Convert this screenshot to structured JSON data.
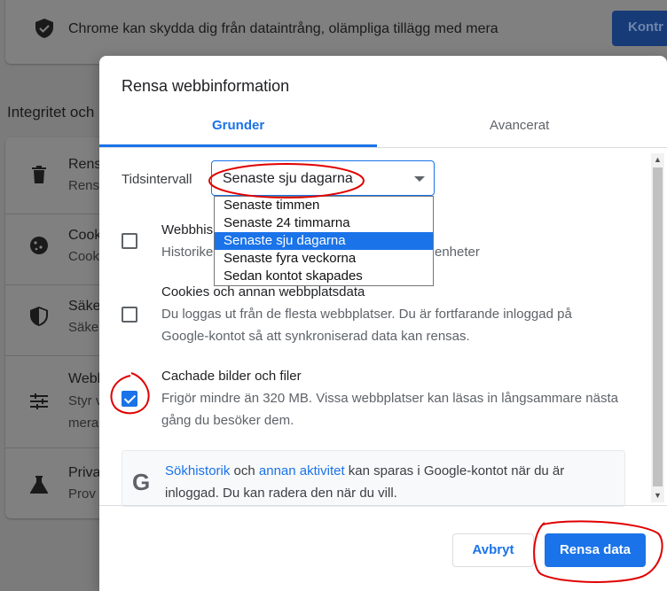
{
  "background": {
    "safety_banner": "Chrome kan skydda dig från dataintrång, olämpliga tillägg med mera",
    "safety_button": "Kontr",
    "section_title": "Integritet och",
    "rows": [
      {
        "icon": "trash-icon",
        "title": "Rens",
        "subtitle": "Rens"
      },
      {
        "icon": "cookie-icon",
        "title": "Cook",
        "subtitle": "Cook"
      },
      {
        "icon": "shield-icon",
        "title": "Säke",
        "subtitle": "Säke"
      },
      {
        "icon": "tune-icon",
        "title": "Webb",
        "subtitle": "Styr v",
        "subtitle2": "mera"
      },
      {
        "icon": "flask-icon",
        "title": "Priva",
        "subtitle": "Prov"
      }
    ]
  },
  "dialog": {
    "title": "Rensa webbinformation",
    "tabs": [
      {
        "label": "Grunder",
        "selected": true
      },
      {
        "label": "Avancerat",
        "selected": false
      }
    ],
    "time_range": {
      "label": "Tidsintervall",
      "value": "Senaste sju dagarna",
      "options": [
        "Senaste timmen",
        "Senaste 24 timmarna",
        "Senaste sju dagarna",
        "Senaste fyra veckorna",
        "Sedan kontot skapades"
      ],
      "selected_index": 2
    },
    "items": [
      {
        "title": "Webbhis",
        "desc": "Historike",
        "desc_tail": "enheter",
        "checked": false
      },
      {
        "title": "Cookies och annan webbplatsdata",
        "desc": "Du loggas ut från de flesta webbplatser. Du är fortfarande inloggad på Google-kontot så att synkroniserad data kan rensas.",
        "checked": false
      },
      {
        "title": "Cachade bilder och filer",
        "desc": "Frigör mindre än 320 MB. Vissa webbplatser kan läsas in långsammare nästa gång du besöker dem.",
        "checked": true
      }
    ],
    "info": {
      "link1": "Sökhistorik",
      "text1": " och ",
      "link2": "annan aktivitet",
      "text2": " kan sparas i Google-kontot när du är inloggad. Du kan radera den när du vill."
    },
    "buttons": {
      "cancel": "Avbryt",
      "clear": "Rensa data"
    }
  },
  "colors": {
    "accent": "#1a73e8",
    "annotation": "#e00000"
  }
}
